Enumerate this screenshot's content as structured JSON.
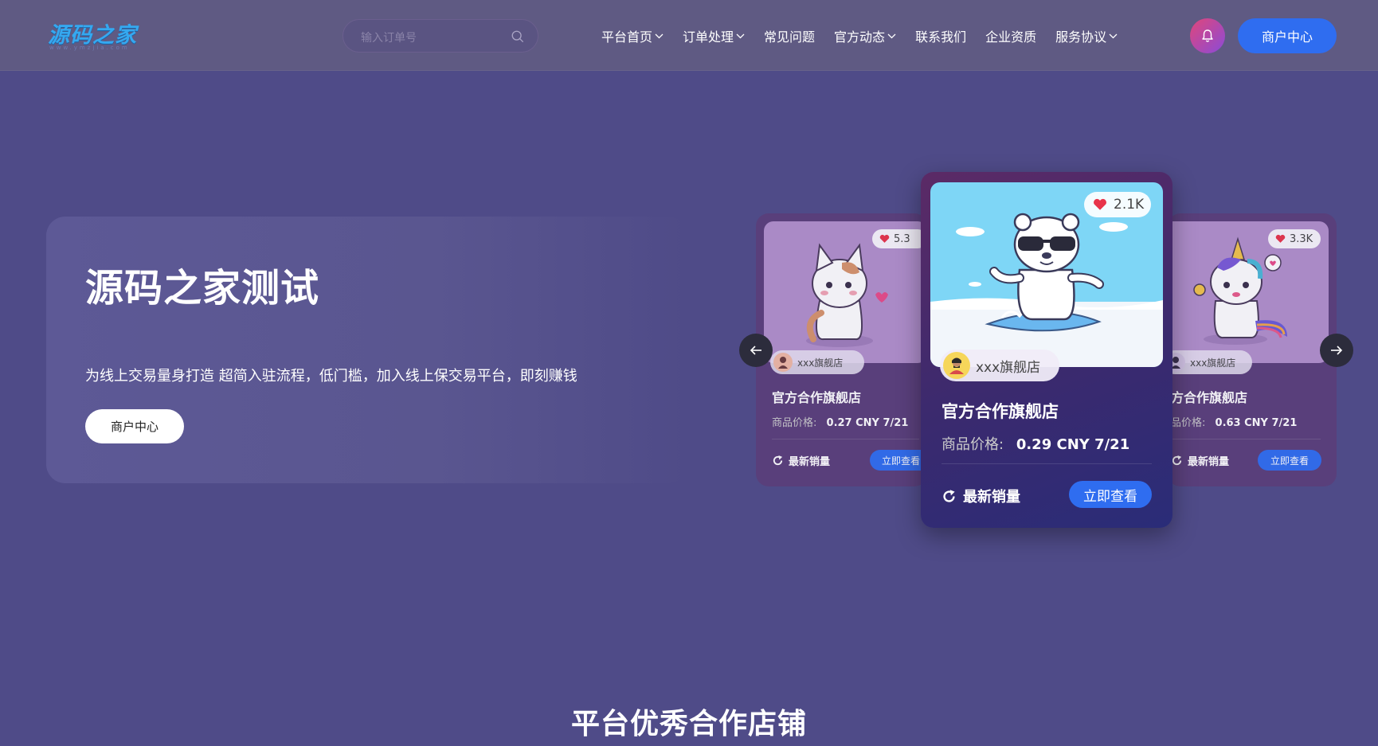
{
  "brand": {
    "logo": "源码之家",
    "logo_sub": "www.ymzjia.com"
  },
  "search": {
    "placeholder": "输入订单号",
    "icon": "search-icon"
  },
  "nav": {
    "items": [
      {
        "label": "平台首页",
        "dropdown": true
      },
      {
        "label": "订单处理",
        "dropdown": true
      },
      {
        "label": "常见问题",
        "dropdown": false
      },
      {
        "label": "官方动态",
        "dropdown": true
      },
      {
        "label": "联系我们",
        "dropdown": false
      },
      {
        "label": "企业资质",
        "dropdown": false
      },
      {
        "label": "服务协议",
        "dropdown": true
      }
    ]
  },
  "header": {
    "bell_icon": "bell-icon",
    "merchant_label": "商户中心"
  },
  "hero": {
    "title": "源码之家测试",
    "description": "为线上交易量身打造 超简入驻流程，低门槛，加入线上保交易平台，即刻赚钱",
    "button": "商户中心"
  },
  "carousel": {
    "cards": [
      {
        "likes": "5.3",
        "shop": "xxx旗舰店",
        "title": "官方合作旗舰店",
        "price_label": "商品价格:",
        "price": "0.27 CNY 7/21",
        "refresh_label": "最新销量",
        "button": "立即查看",
        "image": "cat-illustration"
      },
      {
        "likes": "2.1K",
        "shop": "xxx旗舰店",
        "title": "官方合作旗舰店",
        "price_label": "商品价格:",
        "price": "0.29 CNY 7/21",
        "refresh_label": "最新销量",
        "button": "立即查看",
        "image": "polar-bear-surfing-illustration"
      },
      {
        "likes": "3.3K",
        "shop": "xxx旗舰店",
        "title": "方合作旗舰店",
        "price_label": "品价格:",
        "price": "0.63 CNY 7/21",
        "refresh_label": "最新销量",
        "button": "立即查看",
        "image": "unicorn-illustration"
      }
    ],
    "prev_icon": "arrow-left-icon",
    "next_icon": "arrow-right-icon"
  },
  "section": {
    "title": "平台优秀合作店铺"
  },
  "colors": {
    "accent": "#2f6df0",
    "background": "#4f4b88",
    "topbar": "#5f5a83",
    "heart": "#e8344a"
  }
}
